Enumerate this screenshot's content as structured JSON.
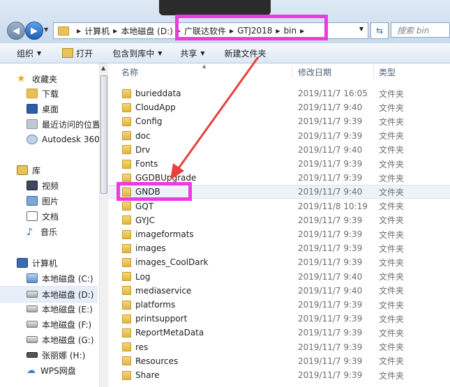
{
  "address": {
    "crumbs": [
      "计算机",
      "本地磁盘 (D:)",
      "广联达软件",
      "GTJ2018",
      "bin"
    ],
    "search_placeholder": "搜索 bin"
  },
  "toolbar": {
    "organize": "组织",
    "open": "打开",
    "include_in_library": "包含到库中",
    "share": "共享",
    "new_folder": "新建文件夹"
  },
  "nav": {
    "favorites_label": "收藏夹",
    "favorites": [
      "下载",
      "桌面",
      "最近访问的位置",
      "Autodesk 360"
    ],
    "library_label": "库",
    "libraries": [
      "视频",
      "图片",
      "文档",
      "音乐"
    ],
    "computer_label": "计算机",
    "drives": [
      "本地磁盘 (C:)",
      "本地磁盘 (D:)",
      "本地磁盘 (E:)",
      "本地磁盘 (F:)",
      "本地磁盘 (G:)",
      "张丽娜 (H:)",
      "WPS网盘"
    ]
  },
  "columns": {
    "name": "名称",
    "date": "修改日期",
    "type": "类型"
  },
  "files": [
    {
      "name": "burieddata",
      "date": "2019/11/7 16:05",
      "type": "文件夹"
    },
    {
      "name": "CloudApp",
      "date": "2019/11/7 9:40",
      "type": "文件夹"
    },
    {
      "name": "Config",
      "date": "2019/11/7 9:39",
      "type": "文件夹"
    },
    {
      "name": "doc",
      "date": "2019/11/7 9:39",
      "type": "文件夹"
    },
    {
      "name": "Drv",
      "date": "2019/11/7 9:40",
      "type": "文件夹"
    },
    {
      "name": "Fonts",
      "date": "2019/11/7 9:39",
      "type": "文件夹"
    },
    {
      "name": "GGDBUpgrade",
      "date": "2019/11/7 9:39",
      "type": "文件夹"
    },
    {
      "name": "GNDB",
      "date": "2019/11/7 9:40",
      "type": "文件夹"
    },
    {
      "name": "GQT",
      "date": "2019/11/8 10:19",
      "type": "文件夹"
    },
    {
      "name": "GYJC",
      "date": "2019/11/7 9:39",
      "type": "文件夹"
    },
    {
      "name": "imageformats",
      "date": "2019/11/7 9:39",
      "type": "文件夹"
    },
    {
      "name": "images",
      "date": "2019/11/7 9:39",
      "type": "文件夹"
    },
    {
      "name": "images_CoolDark",
      "date": "2019/11/7 9:39",
      "type": "文件夹"
    },
    {
      "name": "Log",
      "date": "2019/11/7 9:40",
      "type": "文件夹"
    },
    {
      "name": "mediaservice",
      "date": "2019/11/7 9:40",
      "type": "文件夹"
    },
    {
      "name": "platforms",
      "date": "2019/11/7 9:39",
      "type": "文件夹"
    },
    {
      "name": "printsupport",
      "date": "2019/11/7 9:39",
      "type": "文件夹"
    },
    {
      "name": "ReportMetaData",
      "date": "2019/11/7 9:39",
      "type": "文件夹"
    },
    {
      "name": "res",
      "date": "2019/11/7 9:39",
      "type": "文件夹"
    },
    {
      "name": "Resources",
      "date": "2019/11/7 9:39",
      "type": "文件夹"
    },
    {
      "name": "Share",
      "date": "2019/11/7 9:39",
      "type": "文件夹"
    }
  ],
  "colors": {
    "highlight": "#ee3be0",
    "annotation_arrow": "#e8413c"
  }
}
